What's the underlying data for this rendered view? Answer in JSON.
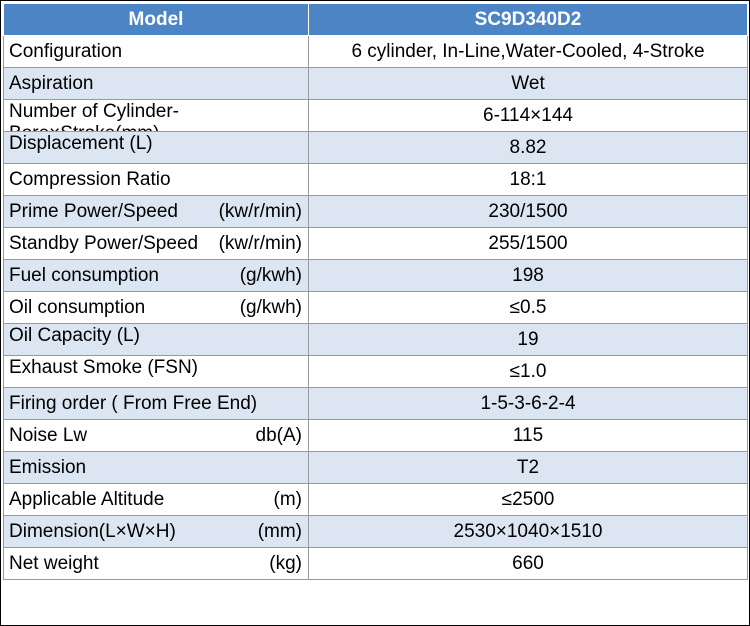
{
  "header": {
    "col1": "Model",
    "col2": "SC9D340D2"
  },
  "rows": [
    {
      "label": "Configuration",
      "unit": "",
      "value": "6 cylinder, In-Line,Water-Cooled, 4-Stroke"
    },
    {
      "label": "Aspiration",
      "unit": "",
      "value": "Wet"
    },
    {
      "label": "Number of Cylinder-Bore×Stroke(mm)",
      "unit": "",
      "value": "6-114×144"
    },
    {
      "label": "Displacement (L)",
      "unit": "",
      "value": "8.82"
    },
    {
      "label": "Compression Ratio",
      "unit": "",
      "value": "18:1"
    },
    {
      "label": "Prime Power/Speed",
      "unit": "(kw/r/min)",
      "value": "230/1500"
    },
    {
      "label": "Standby Power/Speed",
      "unit": "(kw/r/min)",
      "value": "255/1500"
    },
    {
      "label": "Fuel consumption",
      "unit": "(g/kwh)",
      "value": "198"
    },
    {
      "label": "Oil consumption",
      "unit": "(g/kwh)",
      "value": "≤0.5"
    },
    {
      "label": "Oil Capacity (L)",
      "unit": "",
      "value": "19"
    },
    {
      "label": "Exhaust Smoke (FSN)",
      "unit": "",
      "value": "≤1.0"
    },
    {
      "label": "Firing order ( From Free End)",
      "unit": "",
      "value": "1-5-3-6-2-4"
    },
    {
      "label": "Noise Lw",
      "unit": "db(A)",
      "value": "115"
    },
    {
      "label": "Emission",
      "unit": "",
      "value": "T2"
    },
    {
      "label": "Applicable Altitude",
      "unit": "(m)",
      "value": "≤2500"
    },
    {
      "label": "Dimension(L×W×H)",
      "unit": "(mm)",
      "value": "2530×1040×1510"
    },
    {
      "label": "Net weight",
      "unit": "(kg)",
      "value": "660"
    }
  ]
}
